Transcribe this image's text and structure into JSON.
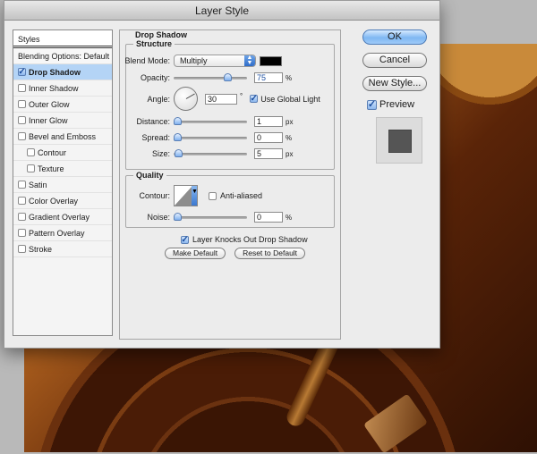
{
  "window": {
    "title": "Layer Style"
  },
  "sidebar": {
    "header": "Styles",
    "items": [
      {
        "label": "Blending Options: Default",
        "checkbox": false,
        "checked": false,
        "indent": false,
        "selected": false
      },
      {
        "label": "Drop Shadow",
        "checkbox": true,
        "checked": true,
        "indent": false,
        "selected": true
      },
      {
        "label": "Inner Shadow",
        "checkbox": true,
        "checked": false,
        "indent": false,
        "selected": false
      },
      {
        "label": "Outer Glow",
        "checkbox": true,
        "checked": false,
        "indent": false,
        "selected": false
      },
      {
        "label": "Inner Glow",
        "checkbox": true,
        "checked": false,
        "indent": false,
        "selected": false
      },
      {
        "label": "Bevel and Emboss",
        "checkbox": true,
        "checked": false,
        "indent": false,
        "selected": false
      },
      {
        "label": "Contour",
        "checkbox": true,
        "checked": false,
        "indent": true,
        "selected": false
      },
      {
        "label": "Texture",
        "checkbox": true,
        "checked": false,
        "indent": true,
        "selected": false
      },
      {
        "label": "Satin",
        "checkbox": true,
        "checked": false,
        "indent": false,
        "selected": false
      },
      {
        "label": "Color Overlay",
        "checkbox": true,
        "checked": false,
        "indent": false,
        "selected": false
      },
      {
        "label": "Gradient Overlay",
        "checkbox": true,
        "checked": false,
        "indent": false,
        "selected": false
      },
      {
        "label": "Pattern Overlay",
        "checkbox": true,
        "checked": false,
        "indent": false,
        "selected": false
      },
      {
        "label": "Stroke",
        "checkbox": true,
        "checked": false,
        "indent": false,
        "selected": false
      }
    ]
  },
  "drop_shadow": {
    "title": "Drop Shadow",
    "structure": {
      "title": "Structure",
      "blend_mode_label": "Blend Mode:",
      "blend_mode_value": "Multiply",
      "shadow_color": "#000000",
      "opacity_label": "Opacity:",
      "opacity_value": "75",
      "opacity_unit": "%",
      "opacity_fraction": 0.75,
      "angle_label": "Angle:",
      "angle_value": "30",
      "angle_unit": "°",
      "use_global_light_label": "Use Global Light",
      "use_global_light_checked": true,
      "distance_label": "Distance:",
      "distance_value": "1",
      "distance_unit": "px",
      "distance_fraction": 0.0,
      "spread_label": "Spread:",
      "spread_value": "0",
      "spread_unit": "%",
      "spread_fraction": 0.0,
      "size_label": "Size:",
      "size_value": "5",
      "size_unit": "px",
      "size_fraction": 0.02
    },
    "quality": {
      "title": "Quality",
      "contour_label": "Contour:",
      "anti_aliased_label": "Anti-aliased",
      "anti_aliased_checked": false,
      "noise_label": "Noise:",
      "noise_value": "0",
      "noise_unit": "%",
      "noise_fraction": 0.0
    },
    "knockout_label": "Layer Knocks Out Drop Shadow",
    "knockout_checked": true,
    "make_default_label": "Make Default",
    "reset_default_label": "Reset to Default"
  },
  "buttons": {
    "ok": "OK",
    "cancel": "Cancel",
    "new_style": "New Style...",
    "preview_label": "Preview",
    "preview_checked": true
  },
  "icons": {
    "check": "✓",
    "updown": "▲▼"
  }
}
